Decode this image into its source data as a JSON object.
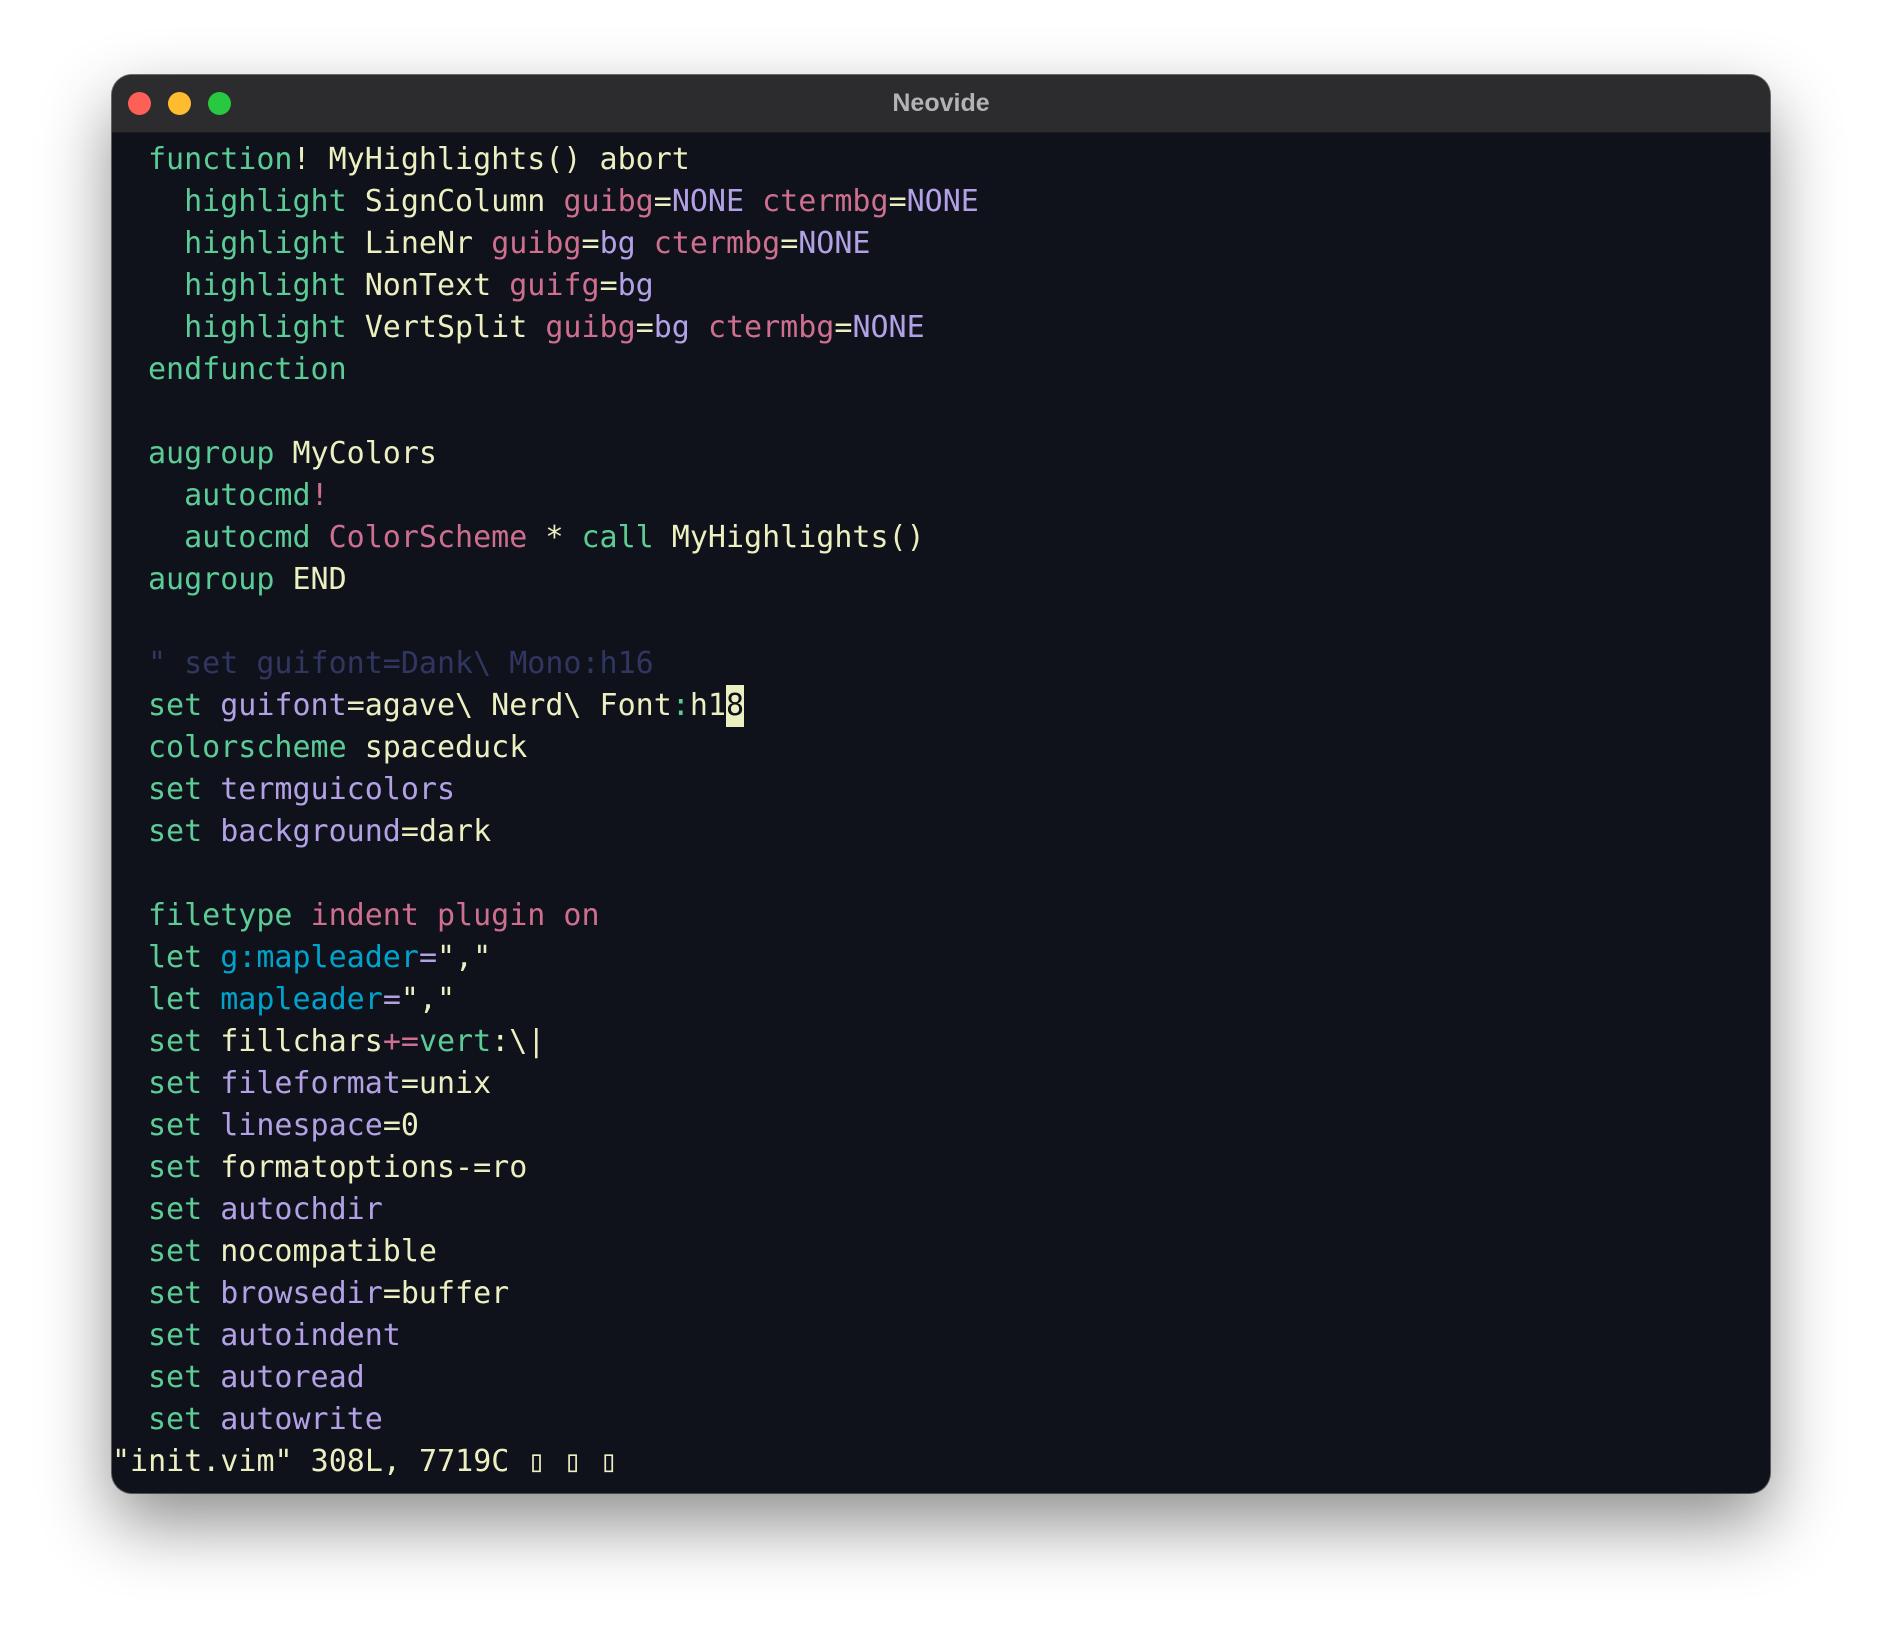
{
  "window": {
    "title": "Neovide",
    "traffic_lights": [
      {
        "name": "close",
        "color": "#fe5f57"
      },
      {
        "name": "minimize",
        "color": "#febc2e"
      },
      {
        "name": "zoom",
        "color": "#28c840"
      }
    ]
  },
  "colors": {
    "background": "#0f111b",
    "titlebar": "#2c2c2f",
    "keyword": "#5ccc96",
    "identifier": "#ecf0c1",
    "attribute": "#ce6f8f",
    "value": "#b3a1e6",
    "global": "#00a3cc",
    "comment": "#30365f",
    "cursor": "#ecf0c1"
  },
  "editor": {
    "lines": [
      [
        {
          "t": "function",
          "c": "keyword"
        },
        {
          "t": "! MyHighlights() abort",
          "c": "identifier"
        }
      ],
      [
        {
          "t": "  highlight",
          "c": "keyword"
        },
        {
          "t": " SignColumn ",
          "c": "identifier"
        },
        {
          "t": "guibg",
          "c": "attribute"
        },
        {
          "t": "=",
          "c": "identifier"
        },
        {
          "t": "NONE",
          "c": "value"
        },
        {
          "t": " ",
          "c": "identifier"
        },
        {
          "t": "ctermbg",
          "c": "attribute"
        },
        {
          "t": "=",
          "c": "identifier"
        },
        {
          "t": "NONE",
          "c": "value"
        }
      ],
      [
        {
          "t": "  highlight",
          "c": "keyword"
        },
        {
          "t": " LineNr ",
          "c": "identifier"
        },
        {
          "t": "guibg",
          "c": "attribute"
        },
        {
          "t": "=",
          "c": "identifier"
        },
        {
          "t": "bg",
          "c": "value"
        },
        {
          "t": " ",
          "c": "identifier"
        },
        {
          "t": "ctermbg",
          "c": "attribute"
        },
        {
          "t": "=",
          "c": "identifier"
        },
        {
          "t": "NONE",
          "c": "value"
        }
      ],
      [
        {
          "t": "  highlight",
          "c": "keyword"
        },
        {
          "t": " NonText ",
          "c": "identifier"
        },
        {
          "t": "guifg",
          "c": "attribute"
        },
        {
          "t": "=",
          "c": "identifier"
        },
        {
          "t": "bg",
          "c": "value"
        }
      ],
      [
        {
          "t": "  highlight",
          "c": "keyword"
        },
        {
          "t": " VertSplit ",
          "c": "identifier"
        },
        {
          "t": "guibg",
          "c": "attribute"
        },
        {
          "t": "=",
          "c": "identifier"
        },
        {
          "t": "bg",
          "c": "value"
        },
        {
          "t": " ",
          "c": "identifier"
        },
        {
          "t": "ctermbg",
          "c": "attribute"
        },
        {
          "t": "=",
          "c": "identifier"
        },
        {
          "t": "NONE",
          "c": "value"
        }
      ],
      [
        {
          "t": "endfunction",
          "c": "keyword"
        }
      ],
      [],
      [
        {
          "t": "augroup",
          "c": "keyword"
        },
        {
          "t": " MyColors",
          "c": "identifier"
        }
      ],
      [
        {
          "t": "  autocmd",
          "c": "keyword"
        },
        {
          "t": "!",
          "c": "attribute"
        }
      ],
      [
        {
          "t": "  autocmd",
          "c": "keyword"
        },
        {
          "t": " ",
          "c": "identifier"
        },
        {
          "t": "ColorScheme",
          "c": "attribute"
        },
        {
          "t": " * ",
          "c": "identifier"
        },
        {
          "t": "call",
          "c": "keyword"
        },
        {
          "t": " MyHighlights()",
          "c": "identifier"
        }
      ],
      [
        {
          "t": "augroup",
          "c": "keyword"
        },
        {
          "t": " END",
          "c": "identifier"
        }
      ],
      [],
      [
        {
          "t": "\" set guifont=Dank\\ Mono:h16",
          "c": "comment"
        }
      ],
      [
        {
          "t": "set",
          "c": "keyword"
        },
        {
          "t": " ",
          "c": "identifier"
        },
        {
          "t": "guifont",
          "c": "value"
        },
        {
          "t": "=agave\\ Nerd\\ Font",
          "c": "identifier"
        },
        {
          "t": ":",
          "c": "keyword"
        },
        {
          "t": "h1",
          "c": "identifier"
        },
        {
          "t": "8",
          "c": "cursor"
        }
      ],
      [
        {
          "t": "colorscheme",
          "c": "keyword"
        },
        {
          "t": " spaceduck",
          "c": "identifier"
        }
      ],
      [
        {
          "t": "set",
          "c": "keyword"
        },
        {
          "t": " ",
          "c": "identifier"
        },
        {
          "t": "termguicolors",
          "c": "value"
        }
      ],
      [
        {
          "t": "set",
          "c": "keyword"
        },
        {
          "t": " ",
          "c": "identifier"
        },
        {
          "t": "background",
          "c": "value"
        },
        {
          "t": "=dark",
          "c": "identifier"
        }
      ],
      [],
      [
        {
          "t": "filetype",
          "c": "keyword"
        },
        {
          "t": " ",
          "c": "identifier"
        },
        {
          "t": "indent plugin on",
          "c": "attribute"
        }
      ],
      [
        {
          "t": "let",
          "c": "keyword"
        },
        {
          "t": " ",
          "c": "identifier"
        },
        {
          "t": "g:mapleader",
          "c": "global"
        },
        {
          "t": "=",
          "c": "value"
        },
        {
          "t": "\",\"",
          "c": "identifier"
        }
      ],
      [
        {
          "t": "let",
          "c": "keyword"
        },
        {
          "t": " ",
          "c": "identifier"
        },
        {
          "t": "mapleader",
          "c": "global"
        },
        {
          "t": "=",
          "c": "value"
        },
        {
          "t": "\",\"",
          "c": "identifier"
        }
      ],
      [
        {
          "t": "set",
          "c": "keyword"
        },
        {
          "t": " fillchars",
          "c": "identifier"
        },
        {
          "t": "+=",
          "c": "attribute"
        },
        {
          "t": "vert",
          "c": "keyword"
        },
        {
          "t": ":\\|",
          "c": "identifier"
        }
      ],
      [
        {
          "t": "set",
          "c": "keyword"
        },
        {
          "t": " ",
          "c": "identifier"
        },
        {
          "t": "fileformat",
          "c": "value"
        },
        {
          "t": "=unix",
          "c": "identifier"
        }
      ],
      [
        {
          "t": "set",
          "c": "keyword"
        },
        {
          "t": " ",
          "c": "identifier"
        },
        {
          "t": "linespace",
          "c": "value"
        },
        {
          "t": "=0",
          "c": "identifier"
        }
      ],
      [
        {
          "t": "set",
          "c": "keyword"
        },
        {
          "t": " formatoptions-=ro",
          "c": "identifier"
        }
      ],
      [
        {
          "t": "set",
          "c": "keyword"
        },
        {
          "t": " ",
          "c": "identifier"
        },
        {
          "t": "autochdir",
          "c": "value"
        }
      ],
      [
        {
          "t": "set",
          "c": "keyword"
        },
        {
          "t": " nocompatible",
          "c": "identifier"
        }
      ],
      [
        {
          "t": "set",
          "c": "keyword"
        },
        {
          "t": " ",
          "c": "identifier"
        },
        {
          "t": "browsedir",
          "c": "value"
        },
        {
          "t": "=buffer",
          "c": "identifier"
        }
      ],
      [
        {
          "t": "set",
          "c": "keyword"
        },
        {
          "t": " ",
          "c": "identifier"
        },
        {
          "t": "autoindent",
          "c": "value"
        }
      ],
      [
        {
          "t": "set",
          "c": "keyword"
        },
        {
          "t": " ",
          "c": "identifier"
        },
        {
          "t": "autoread",
          "c": "value"
        }
      ],
      [
        {
          "t": "set",
          "c": "keyword"
        },
        {
          "t": " ",
          "c": "identifier"
        },
        {
          "t": "autowrite",
          "c": "value"
        }
      ]
    ],
    "cmdline": "\"init.vim\" 308L, 7719C ▯ ▯ ▯"
  }
}
